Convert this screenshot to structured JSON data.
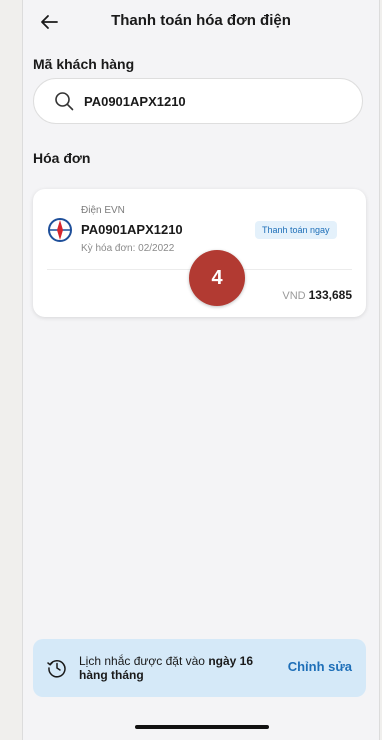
{
  "header": {
    "title": "Thanh toán hóa đơn điện",
    "back_icon": "arrow-left-icon"
  },
  "customer": {
    "label": "Mã khách hàng",
    "search_value": "PA0901APX1210",
    "search_icon": "search-icon"
  },
  "bills": {
    "label": "Hóa đơn",
    "items": [
      {
        "provider": "Điện EVN",
        "code": "PA0901APX1210",
        "period": "Kỳ hóa đơn: 02/2022",
        "pay_label": "Thanh toán ngay",
        "currency": "VND",
        "amount": "133,685",
        "logo_icon": "evn-logo-icon"
      }
    ]
  },
  "step_badge": "4",
  "reminder": {
    "text_prefix": "Lịch nhắc được đặt vào",
    "text_strong": "ngày 16 hàng tháng",
    "edit_label": "Chỉnh sửa",
    "icon": "clock-history-icon"
  },
  "colors": {
    "accent_blue": "#1e6fb8",
    "badge_red": "#b23a32",
    "reminder_bg": "#d5e9f8"
  }
}
